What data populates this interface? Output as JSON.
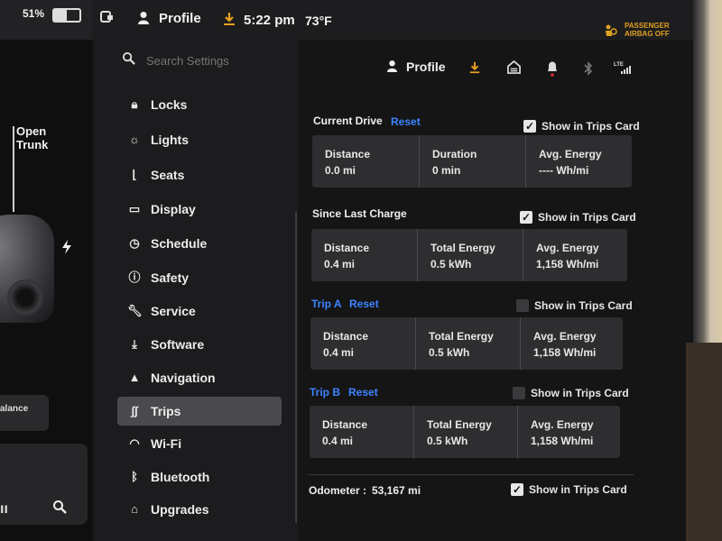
{
  "status": {
    "battery_percent": "51%",
    "profile": "Profile",
    "time": "5:22 pm",
    "temperature": "73°F",
    "airbag_line1": "PASSENGER",
    "airbag_line2": "AIRBAG OFF"
  },
  "car_panel": {
    "trunk_line1": "Open",
    "trunk_line2": "Trunk",
    "balance_label": "alance"
  },
  "search": {
    "placeholder": "Search Settings"
  },
  "header": {
    "profile": "Profile"
  },
  "menu": [
    {
      "label": "Locks",
      "icon": "lock-icon"
    },
    {
      "label": "Lights",
      "icon": "light-icon"
    },
    {
      "label": "Seats",
      "icon": "seat-icon"
    },
    {
      "label": "Display",
      "icon": "display-icon"
    },
    {
      "label": "Schedule",
      "icon": "clock-icon"
    },
    {
      "label": "Safety",
      "icon": "safety-icon"
    },
    {
      "label": "Service",
      "icon": "wrench-icon"
    },
    {
      "label": "Software",
      "icon": "download-icon"
    },
    {
      "label": "Navigation",
      "icon": "navigation-icon"
    },
    {
      "label": "Trips",
      "icon": "trips-icon",
      "active": true
    },
    {
      "label": "Wi-Fi",
      "icon": "wifi-icon"
    },
    {
      "label": "Bluetooth",
      "icon": "bluetooth-icon"
    },
    {
      "label": "Upgrades",
      "icon": "upgrades-icon"
    }
  ],
  "show_in_trips_card": "Show in Trips Card",
  "reset": "Reset",
  "current_drive": {
    "title": "Current Drive",
    "checked": true,
    "cells": [
      {
        "label": "Distance",
        "value": "0.0 mi"
      },
      {
        "label": "Duration",
        "value": "0 min"
      },
      {
        "label": "Avg. Energy",
        "value": "---- Wh/mi"
      }
    ]
  },
  "since_last_charge": {
    "title": "Since Last Charge",
    "checked": true,
    "cells": [
      {
        "label": "Distance",
        "value": "0.4 mi"
      },
      {
        "label": "Total Energy",
        "value": "0.5 kWh"
      },
      {
        "label": "Avg. Energy",
        "value": "1,158 Wh/mi"
      }
    ]
  },
  "trip_a": {
    "title": "Trip A",
    "checked": false,
    "cells": [
      {
        "label": "Distance",
        "value": "0.4 mi"
      },
      {
        "label": "Total Energy",
        "value": "0.5 kWh"
      },
      {
        "label": "Avg. Energy",
        "value": "1,158 Wh/mi"
      }
    ]
  },
  "trip_b": {
    "title": "Trip B",
    "checked": false,
    "cells": [
      {
        "label": "Distance",
        "value": "0.4 mi"
      },
      {
        "label": "Total Energy",
        "value": "0.5 kWh"
      },
      {
        "label": "Avg. Energy",
        "value": "1,158 Wh/mi"
      }
    ]
  },
  "odometer": {
    "label": "Odometer :",
    "value": "53,167 mi",
    "checked": true
  }
}
